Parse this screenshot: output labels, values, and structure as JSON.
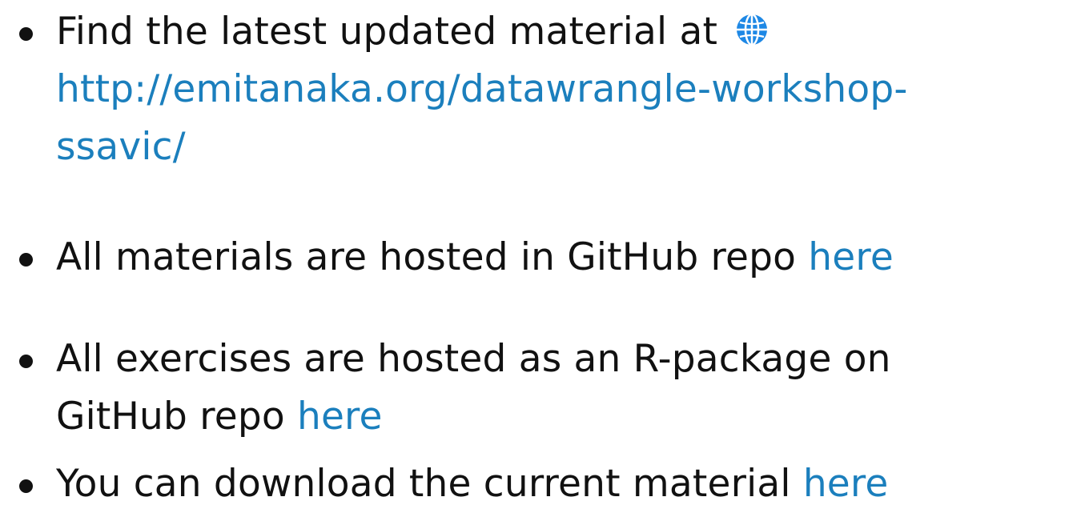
{
  "items": [
    {
      "text_before": "Find the latest updated material at",
      "globe_icon": "globe-icon",
      "url_line1": "http://emitanaka.org/datawrangle-workshop-",
      "url_line2": "ssavic/"
    },
    {
      "text": "All materials are hosted in GitHub repo",
      "link_text": "here"
    },
    {
      "text_line1": "All exercises are hosted as an R-package on",
      "text_line2": "GitHub repo",
      "link_text": "here"
    },
    {
      "text": "You can download the current material",
      "link_text": "here"
    }
  ],
  "colors": {
    "text": "#111111",
    "link": "#1b7fbd",
    "globe": "#1e88e5"
  }
}
